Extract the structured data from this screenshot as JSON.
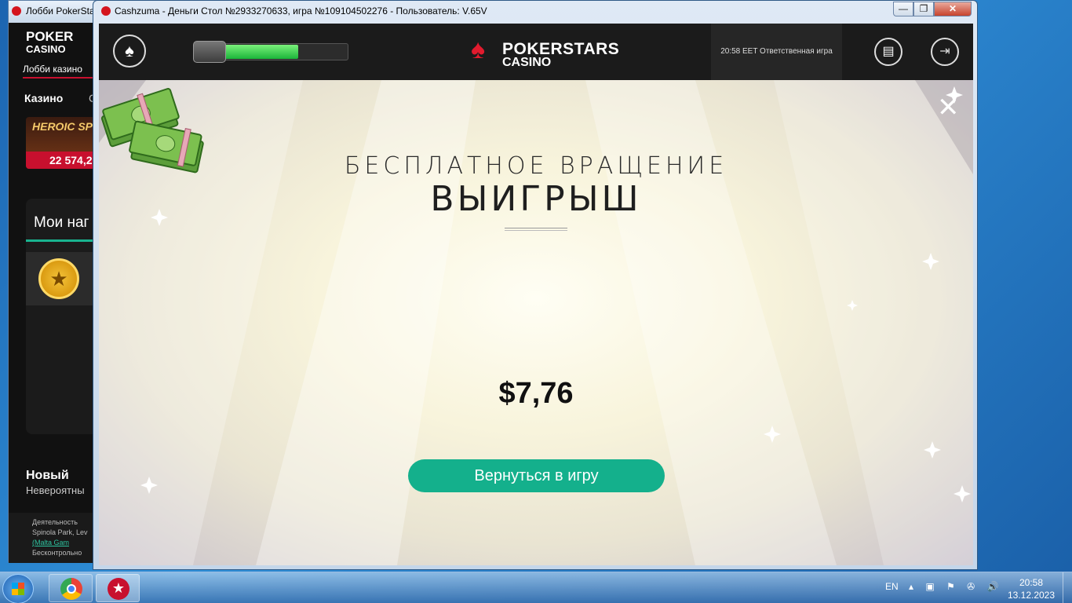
{
  "lobby_window": {
    "title": "Лобби PokerSta",
    "logo_line1": "POKER",
    "logo_line2": "CASINO",
    "subtitle": "Лобби казино",
    "tab_active": "Казино",
    "tab_next": "С",
    "game_tile_title": "HEROIC SP",
    "game_tile_jackpot": "22 574,2",
    "my_rewards_heading": "Мои наг",
    "new_heading": "Новый",
    "new_sub": "Невероятны",
    "footer": [
      "Деятельность",
      "Spinola Park, Lev",
      "(Malta Gam",
      "Бесконтрольно"
    ]
  },
  "main_window": {
    "title": "Cashzuma - Деньги Стол №2933270633, игра №109104502276 - Пользователь: V.65V",
    "controls": {
      "minimize": "—",
      "maximize": "❐",
      "close": "✕"
    }
  },
  "header": {
    "logo_top": "POKERSTARS",
    "logo_bottom": "CASINO",
    "responsible_gaming": "20:58 EET Ответственная игра",
    "progress": 0.6
  },
  "win_dialog": {
    "title_line1": "БЕСПЛАТНОЕ ВРАЩЕНИЕ",
    "title_line2": "ВЫИГРЫШ",
    "amount": "$7,76",
    "back_button": "Вернуться в игру",
    "close": "✕"
  },
  "taskbar": {
    "lang": "EN",
    "time": "20:58",
    "date": "13.12.2023"
  },
  "colors": {
    "accent": "#14b08c",
    "brand_red": "#e21b2e",
    "header_bg": "#1b1b1b"
  }
}
